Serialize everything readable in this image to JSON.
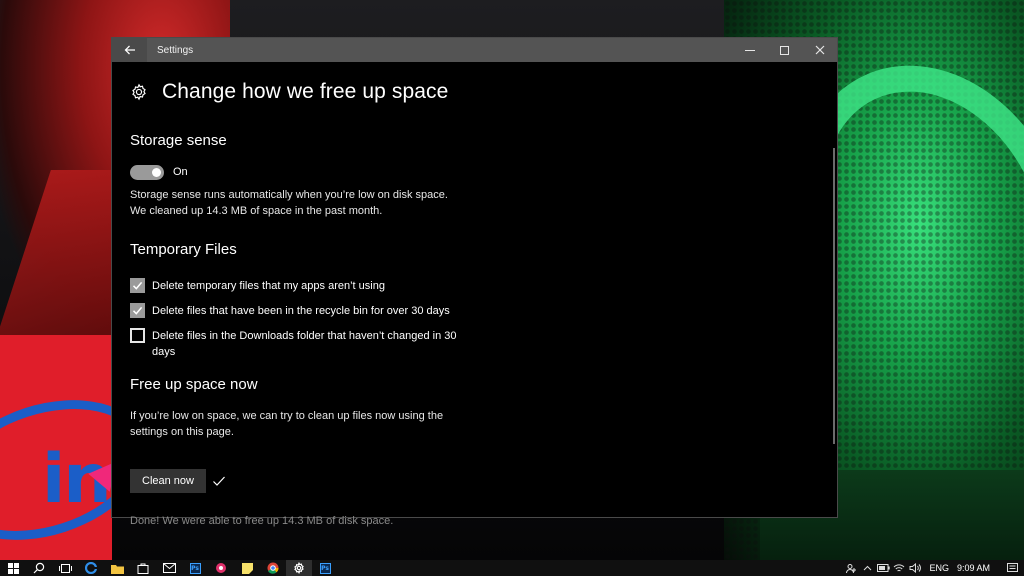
{
  "window": {
    "title": "Settings"
  },
  "page": {
    "title": "Change how we free up space"
  },
  "storage_sense": {
    "heading": "Storage sense",
    "toggle_state": "On",
    "description_line1": "Storage sense runs automatically when you’re low on disk space.",
    "description_line2": "We cleaned up 14.3 MB of space in the past month."
  },
  "temporary_files": {
    "heading": "Temporary Files",
    "options": [
      {
        "label": "Delete temporary files that my apps aren’t using",
        "checked": true
      },
      {
        "label": "Delete files that have been in the recycle bin for over 30 days",
        "checked": true
      },
      {
        "label": "Delete files in the Downloads folder that haven’t changed in 30 days",
        "checked": false
      }
    ]
  },
  "free_up": {
    "heading": "Free up space now",
    "description": "If you’re low on space, we can try to clean up files now using the settings on this page.",
    "button_label": "Clean now",
    "result_message": "Done! We were able to free up 14.3 MB of disk space."
  },
  "taskbar": {
    "apps": [
      "windows-logo",
      "search",
      "task-view",
      "edge",
      "file-explorer",
      "store",
      "mail",
      "photoshop",
      "app-red",
      "sticky-notes",
      "chrome",
      "settings",
      "photoshop"
    ],
    "ps_label": "Ps",
    "language": "ENG",
    "time": "9:09 AM"
  },
  "colors": {
    "window_bg": "#000000",
    "titlebar": "#545454",
    "toggle_on": "#9a9a9a",
    "muted_text": "#8a8a8a"
  }
}
